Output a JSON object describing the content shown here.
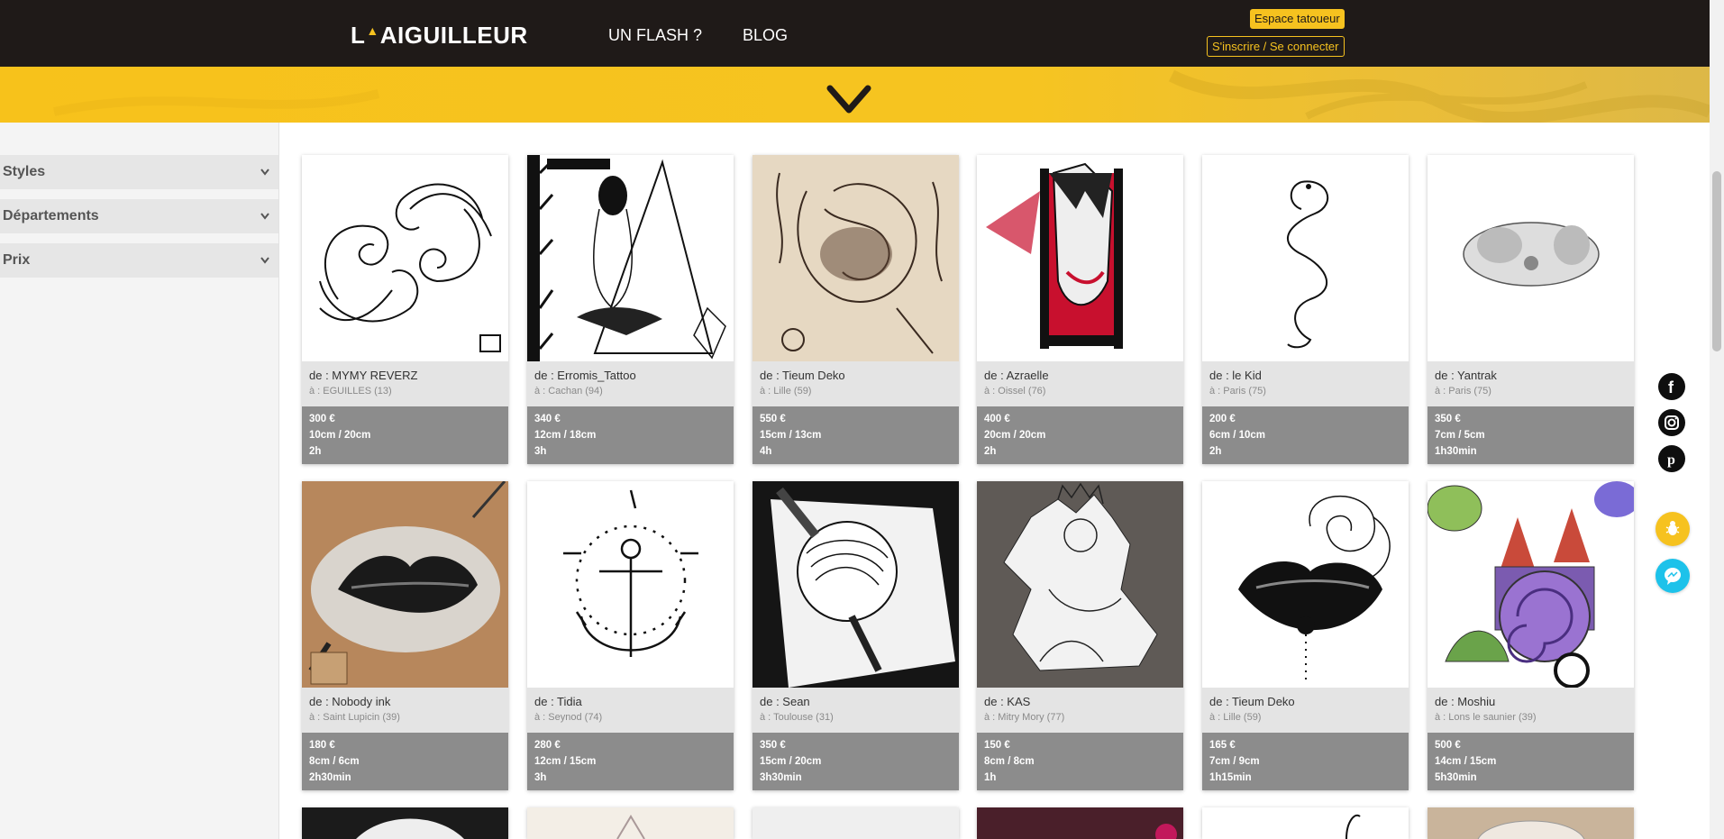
{
  "header": {
    "logo_left": "L",
    "logo_mark": "'",
    "logo_right": "AIGUILLEUR",
    "nav": [
      "UN FLASH ?",
      "BLOG"
    ],
    "espace_button": "Espace tatoueur",
    "login_button": "S'inscrire / Se connecter"
  },
  "filters": [
    {
      "label": "Styles"
    },
    {
      "label": "Départements"
    },
    {
      "label": "Prix"
    }
  ],
  "cards": [
    {
      "author": "de : MYMY REVERZ",
      "city": "à : EGUILLES (13)",
      "price": "300 €",
      "size": "10cm / 20cm",
      "duration": "2h"
    },
    {
      "author": "de : Erromis_Tattoo",
      "city": "à : Cachan (94)",
      "price": "340 €",
      "size": "12cm / 18cm",
      "duration": "3h"
    },
    {
      "author": "de : Tieum Deko",
      "city": "à : Lille (59)",
      "price": "550 €",
      "size": "15cm / 13cm",
      "duration": "4h"
    },
    {
      "author": "de : Azraelle",
      "city": "à : Oissel (76)",
      "price": "400 €",
      "size": "20cm / 20cm",
      "duration": "2h"
    },
    {
      "author": "de : le Kid",
      "city": "à : Paris (75)",
      "price": "200 €",
      "size": "6cm / 10cm",
      "duration": "2h"
    },
    {
      "author": "de : Yantrak",
      "city": "à : Paris (75)",
      "price": "350 €",
      "size": "7cm / 5cm",
      "duration": "1h30min"
    },
    {
      "author": "de : Nobody ink",
      "city": "à : Saint Lupicin (39)",
      "price": "180 €",
      "size": "8cm / 6cm",
      "duration": "2h30min"
    },
    {
      "author": "de : Tidia",
      "city": "à : Seynod (74)",
      "price": "280 €",
      "size": "12cm / 15cm",
      "duration": "3h"
    },
    {
      "author": "de : Sean",
      "city": "à : Toulouse (31)",
      "price": "350 €",
      "size": "15cm / 20cm",
      "duration": "3h30min"
    },
    {
      "author": "de : KAS",
      "city": "à : Mitry Mory (77)",
      "price": "150 €",
      "size": "8cm / 8cm",
      "duration": "1h"
    },
    {
      "author": "de : Tieum Deko",
      "city": "à : Lille (59)",
      "price": "165 €",
      "size": "7cm / 9cm",
      "duration": "1h15min"
    },
    {
      "author": "de : Moshiu",
      "city": "à : Lons le saunier (39)",
      "price": "500 €",
      "size": "14cm / 15cm",
      "duration": "5h30min"
    }
  ],
  "social": [
    "facebook-icon",
    "instagram-icon",
    "pinterest-icon"
  ],
  "floating": [
    "bug-report-icon",
    "messenger-icon"
  ],
  "colors": {
    "brand_yellow": "#f6c21f",
    "header_dark": "#1f1a18",
    "messenger_blue": "#1dc2ea"
  }
}
